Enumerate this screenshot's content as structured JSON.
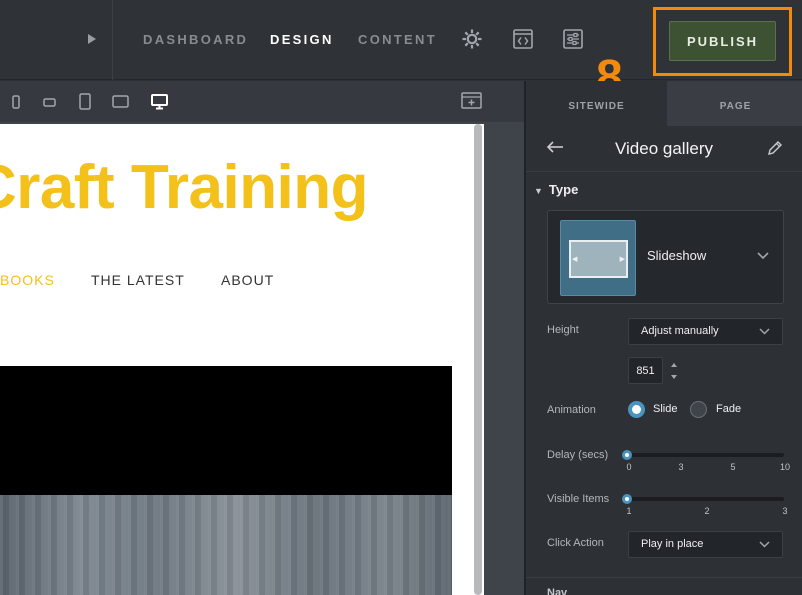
{
  "topbar": {
    "tabs": [
      {
        "label": "DASHBOARD",
        "active": false
      },
      {
        "label": "DESIGN",
        "active": true
      },
      {
        "label": "CONTENT",
        "active": false
      }
    ],
    "icons": [
      "play-icon",
      "gear-icon",
      "code-icon",
      "sliders-icon"
    ],
    "publish_label": "PUBLISH",
    "annotation_number": "8"
  },
  "canvas": {
    "devices": [
      "phone-small-icon",
      "phone-landscape-icon",
      "tablet-icon",
      "tablet-landscape-icon",
      "desktop-icon"
    ],
    "active_device": "desktop-icon",
    "site_title": "Craft Training",
    "site_nav": [
      {
        "label": "BOOKS",
        "active": true
      },
      {
        "label": "THE LATEST",
        "active": false
      },
      {
        "label": "ABOUT",
        "active": false
      }
    ]
  },
  "panel": {
    "tabs": [
      "SITEWIDE",
      "PAGE"
    ],
    "title": "Video gallery",
    "section_type": "Type",
    "type_value": "Slideshow",
    "height_label": "Height",
    "height_value": "Adjust manually",
    "height_number": "851",
    "animation_label": "Animation",
    "animation_options": [
      "Slide",
      "Fade"
    ],
    "animation_selected": "Slide",
    "delay_label": "Delay (secs)",
    "delay_ticks": [
      "0",
      "3",
      "5",
      "10"
    ],
    "delay_value": 0,
    "visible_items_label": "Visible Items",
    "visible_items_ticks": [
      "1",
      "2",
      "3"
    ],
    "visible_items_value": 1,
    "click_action_label": "Click Action",
    "click_action_value": "Play in place",
    "next_section_label": "Nav"
  },
  "colors": {
    "accent_orange": "#f28a10",
    "site_yellow": "#f3c11a",
    "publish_green": "#3d5233",
    "control_blue": "#4a93c0"
  }
}
